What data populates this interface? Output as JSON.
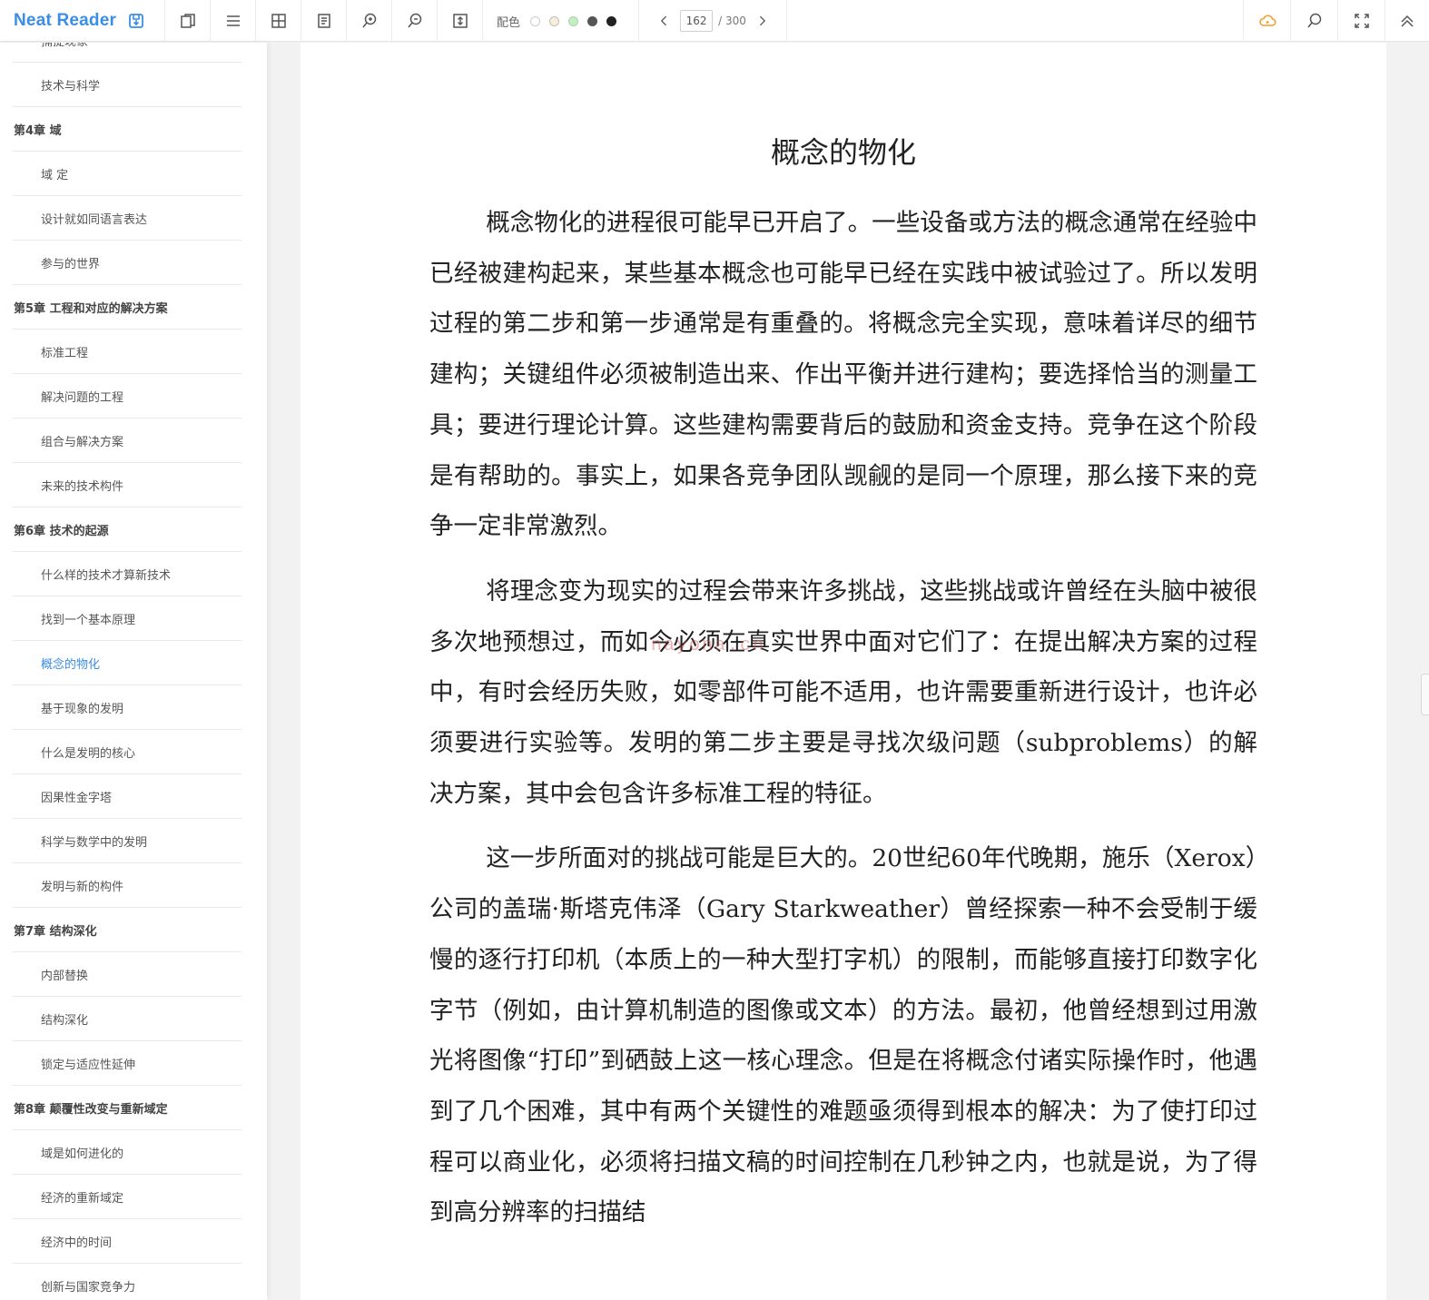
{
  "app": {
    "name": "Neat Reader"
  },
  "toolbar": {
    "color_label": "配色",
    "swatch_colors": [
      "#ffffff",
      "#f6efe0",
      "#c8ecc5",
      "#555555",
      "#222222"
    ],
    "page_current": "162",
    "page_total": "/ 300"
  },
  "toc": [
    {
      "label": "捕捉现象",
      "level": "sub"
    },
    {
      "label": "技术与科学",
      "level": "sub"
    },
    {
      "label": "第4章 域",
      "level": "chapter"
    },
    {
      "label": "域 定",
      "level": "sub"
    },
    {
      "label": "设计就如同语言表达",
      "level": "sub"
    },
    {
      "label": "参与的世界",
      "level": "sub"
    },
    {
      "label": "第5章 工程和对应的解决方案",
      "level": "chapter"
    },
    {
      "label": "标准工程",
      "level": "sub"
    },
    {
      "label": "解决问题的工程",
      "level": "sub"
    },
    {
      "label": "组合与解决方案",
      "level": "sub"
    },
    {
      "label": "未来的技术构件",
      "level": "sub"
    },
    {
      "label": "第6章 技术的起源",
      "level": "chapter"
    },
    {
      "label": "什么样的技术才算新技术",
      "level": "sub"
    },
    {
      "label": "找到一个基本原理",
      "level": "sub"
    },
    {
      "label": "概念的物化",
      "level": "sub",
      "active": true
    },
    {
      "label": "基于现象的发明",
      "level": "sub"
    },
    {
      "label": "什么是发明的核心",
      "level": "sub"
    },
    {
      "label": "因果性金字塔",
      "level": "sub"
    },
    {
      "label": "科学与数学中的发明",
      "level": "sub"
    },
    {
      "label": "发明与新的构件",
      "level": "sub"
    },
    {
      "label": "第7章 结构深化",
      "level": "chapter"
    },
    {
      "label": "内部替换",
      "level": "sub"
    },
    {
      "label": "结构深化",
      "level": "sub"
    },
    {
      "label": "锁定与适应性延伸",
      "level": "sub"
    },
    {
      "label": "第8章 颠覆性改变与重新域定",
      "level": "chapter"
    },
    {
      "label": "域是如何进化的",
      "level": "sub"
    },
    {
      "label": "经济的重新域定",
      "level": "sub"
    },
    {
      "label": "经济中的时间",
      "level": "sub"
    },
    {
      "label": "创新与国家竞争力",
      "level": "sub"
    }
  ],
  "content": {
    "title": "概念的物化",
    "paragraphs": [
      "概念物化的进程很可能早已开启了。一些设备或方法的概念通常在经验中已经被建构起来，某些基本概念也可能早已经在实践中被试验过了。所以发明过程的第二步和第一步通常是有重叠的。将概念完全实现，意味着详尽的细节建构；关键组件必须被制造出来、作出平衡并进行建构；要选择恰当的测量工具；要进行理论计算。这些建构需要背后的鼓励和资金支持。竞争在这个阶段是有帮助的。事实上，如果各竞争团队觊觎的是同一个原理，那么接下来的竞争一定非常激烈。",
      "将理念变为现实的过程会带来许多挑战，这些挑战或许曾经在头脑中被很多次地预想过，而如今必须在真实世界中面对它们了：在提出解决方案的过程中，有时会经历失败，如零部件可能不适用，也许需要重新进行设计，也许必须要进行实验等。发明的第二步主要是寻找次级问题（subproblems）的解决方案，其中会包含许多标准工程的特征。",
      "这一步所面对的挑战可能是巨大的。20世纪60年代晚期，施乐（Xerox）公司的盖瑞·斯塔克伟泽（Gary Starkweather）曾经探索一种不会受制于缓慢的逐行打印机（本质上的一种大型打字机）的限制，而能够直接打印数字化字节（例如，由计算机制造的图像或文本）的方法。最初，他曾经想到过用激光将图像“打印”到硒鼓上这一核心理念。但是在将概念付诸实际操作时，他遇到了几个困难，其中有两个关键性的难题亟须得到根本的解决：为了使打印过程可以商业化，必须将扫描文稿的时间控制在几秒钟之内，也就是说，为了得到高分辨率的扫描结"
    ],
    "watermark": "nayona.cn"
  }
}
